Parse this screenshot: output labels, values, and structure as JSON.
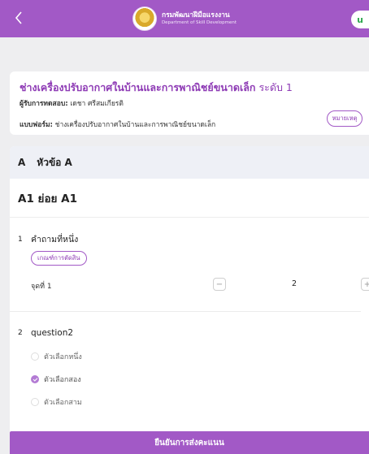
{
  "app_bar": {
    "org_name_th": "กรมพัฒนาฝีมือแรงงาน",
    "org_name_en": "Department of Skill Development",
    "avatar_initial": "u",
    "background": "#a259c6"
  },
  "header": {
    "title": "ช่างเครื่องปรับอากาศในบ้านและการพาณิชย์ขนาดเล็ก",
    "level": "ระดับ 1",
    "examinee_label": "ผู้รับการทดสอบ:",
    "examinee_name": "เดชา ศรีสมเกียรติ",
    "form_label": "แบบฟอร์ม:",
    "form_name": "ช่างเครื่องปรับอากาศในบ้านและการพาณิชย์ขนาดเล็ก",
    "note_button": "หมายเหตุ"
  },
  "section": {
    "letter": "A",
    "title": "หัวข้อ A",
    "subsection_title": "A1 ย่อย A1"
  },
  "questions": [
    {
      "number": "1",
      "text": "คำถามที่หนึ่ง",
      "criteria_label": "เกณฑ์การตัดสิน",
      "point_label": "จุดที่ 1",
      "minus": "−",
      "plus": "+",
      "value": "2"
    },
    {
      "number": "2",
      "text": "question2",
      "options": [
        {
          "label": "ตัวเลือกหนึ่ง",
          "selected": false
        },
        {
          "label": "ตัวเลือกสอง",
          "selected": true
        },
        {
          "label": "ตัวเลือกสาม",
          "selected": false
        }
      ]
    }
  ],
  "confirm_button": "ยืนยันการส่งคะแนน",
  "colors": {
    "accent": "#a259c6",
    "accent_text": "#8e3bb5",
    "page_bg": "#eeeef0",
    "section_bg": "#eef0f6"
  }
}
